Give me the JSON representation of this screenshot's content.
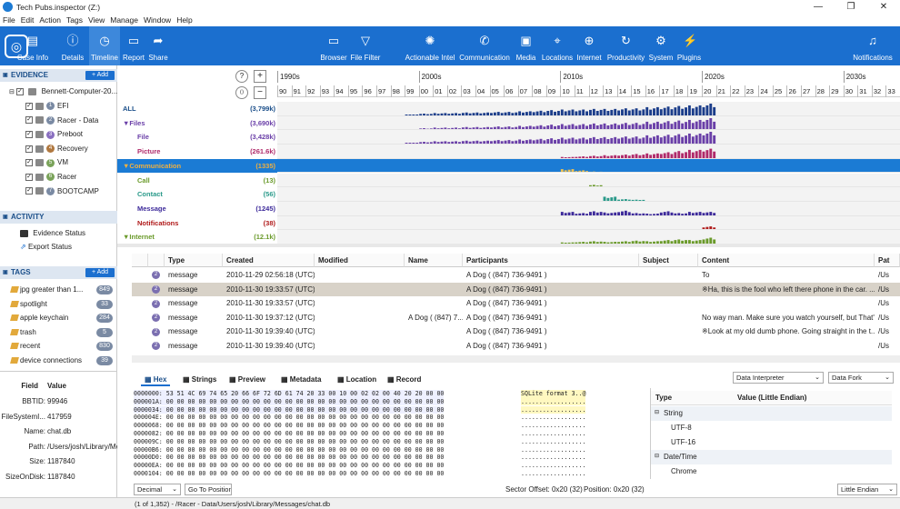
{
  "window": {
    "title": "Tech Pubs.inspector (Z:)",
    "controls": [
      "—",
      "❐",
      "✕"
    ]
  },
  "menu": [
    "File",
    "Edit",
    "Action",
    "Tags",
    "View",
    "Manage",
    "Window",
    "Help"
  ],
  "ribbon": {
    "left": [
      {
        "label": "Case Info",
        "icon": "case-info-icon",
        "glyph": "▤"
      },
      {
        "label": "Details",
        "icon": "details-icon",
        "glyph": "ⓘ"
      },
      {
        "label": "Timeline",
        "icon": "timeline-icon",
        "glyph": "◷",
        "active": true
      },
      {
        "label": "Report",
        "icon": "report-icon",
        "glyph": "▭"
      },
      {
        "label": "Share",
        "icon": "share-icon",
        "glyph": "➦"
      }
    ],
    "center": [
      {
        "label": "Browser",
        "icon": "folder-icon",
        "glyph": "▭"
      },
      {
        "label": "File Filter",
        "icon": "filter-icon",
        "glyph": "▽"
      },
      {
        "label": "Actionable Intel",
        "icon": "intel-icon",
        "glyph": "✺"
      },
      {
        "label": "Communication",
        "icon": "phone-icon",
        "glyph": "✆"
      },
      {
        "label": "Media",
        "icon": "media-icon",
        "glyph": "▣"
      },
      {
        "label": "Locations",
        "icon": "location-pin-icon",
        "glyph": "⌖"
      },
      {
        "label": "Internet",
        "icon": "globe-icon",
        "glyph": "⊕"
      },
      {
        "label": "Productivity",
        "icon": "productivity-icon",
        "glyph": "↻"
      },
      {
        "label": "System",
        "icon": "gear-icon",
        "glyph": "⚙"
      },
      {
        "label": "Plugins",
        "icon": "plugin-icon",
        "glyph": "⚡"
      }
    ],
    "right": {
      "label": "Notifications",
      "icon": "bell-icon",
      "glyph": "♫"
    }
  },
  "evidence": {
    "title": "EVIDENCE",
    "add_label": "+ Add",
    "root": "Bennett-Computer-20...",
    "volumes": [
      {
        "n": "1",
        "name": "EFI",
        "color": "#7a8aa3"
      },
      {
        "n": "2",
        "name": "Racer - Data",
        "color": "#7a8aa3"
      },
      {
        "n": "3",
        "name": "Preboot",
        "color": "#8a6fc0"
      },
      {
        "n": "4",
        "name": "Recovery",
        "color": "#b0783f"
      },
      {
        "n": "5",
        "name": "VM",
        "color": "#7aa35a"
      },
      {
        "n": "6",
        "name": "Racer",
        "color": "#7aa35a"
      },
      {
        "n": "7",
        "name": "BOOTCAMP",
        "color": "#7a8aa3"
      }
    ]
  },
  "activity": {
    "title": "ACTIVITY",
    "items": [
      "Evidence Status",
      "Export Status"
    ]
  },
  "tags": {
    "title": "TAGS",
    "add_label": "+ Add",
    "items": [
      {
        "name": "jpg greater than 1...",
        "count": "849"
      },
      {
        "name": "spotlight",
        "count": "33"
      },
      {
        "name": "apple keychain",
        "count": "284"
      },
      {
        "name": "trash",
        "count": "5"
      },
      {
        "name": "recent",
        "count": "830"
      },
      {
        "name": "device connections",
        "count": "39"
      }
    ]
  },
  "fieldvalue": {
    "headers": [
      "Field",
      "Value"
    ],
    "rows": [
      {
        "field": "BBTID:",
        "value": "99946"
      },
      {
        "field": "FileSystemI...",
        "value": "417959"
      },
      {
        "field": "Name:",
        "value": "chat.db"
      },
      {
        "field": "Path:",
        "value": "/Users/josh/Library/Me"
      },
      {
        "field": "Size:",
        "value": "1187840"
      },
      {
        "field": "SizeOnDisk:",
        "value": "1187840"
      }
    ]
  },
  "timeline": {
    "zoom_buttons": [
      "?",
      "+",
      "⟨⟩",
      "−"
    ],
    "decades": [
      {
        "label": "1990s",
        "start": 0
      },
      {
        "label": "2000s",
        "start": 10
      },
      {
        "label": "2010s",
        "start": 20
      },
      {
        "label": "2020s",
        "start": 30
      },
      {
        "label": "2030s",
        "start": 40
      }
    ],
    "years": [
      "90",
      "91",
      "92",
      "93",
      "94",
      "95",
      "96",
      "97",
      "98",
      "99",
      "00",
      "01",
      "02",
      "03",
      "04",
      "05",
      "06",
      "07",
      "08",
      "09",
      "10",
      "11",
      "12",
      "13",
      "14",
      "15",
      "16",
      "17",
      "18",
      "19",
      "20",
      "21",
      "22",
      "23",
      "24",
      "25",
      "26",
      "27",
      "28",
      "29",
      "30",
      "31",
      "32",
      "33"
    ],
    "rows": [
      {
        "label": "ALL",
        "count": "(3,799k)",
        "color": "#1b4f8a",
        "bar_color": "#1b3d8a",
        "indent": 0,
        "selected": false,
        "levels": [
          0,
          0,
          0,
          0,
          0,
          0,
          0,
          0,
          0,
          0.05,
          0.15,
          0.2,
          0.2,
          0.25,
          0.25,
          0.3,
          0.3,
          0.35,
          0.4,
          0.45,
          0.5,
          0.5,
          0.55,
          0.55,
          0.6,
          0.6,
          0.7,
          0.75,
          0.8,
          0.85,
          1,
          0,
          0,
          0,
          0,
          0,
          0,
          0,
          0,
          0,
          0,
          0,
          0,
          0
        ]
      },
      {
        "label": "▼Files",
        "count": "(3,690k)",
        "color": "#6a3fa8",
        "bar_color": "#6a3fa8",
        "indent": 0,
        "selected": false,
        "levels": [
          0,
          0,
          0,
          0,
          0,
          0,
          0,
          0,
          0,
          0.05,
          0.15,
          0.2,
          0.2,
          0.25,
          0.25,
          0.3,
          0.3,
          0.35,
          0.4,
          0.45,
          0.5,
          0.5,
          0.55,
          0.55,
          0.6,
          0.6,
          0.7,
          0.75,
          0.8,
          0.85,
          1,
          0,
          0,
          0,
          0,
          0,
          0,
          0,
          0,
          0,
          0,
          0,
          0,
          0
        ]
      },
      {
        "label": "File",
        "count": "(3,428k)",
        "color": "#6a3fa8",
        "bar_color": "#6a3fa8",
        "indent": 16,
        "selected": false,
        "levels": [
          0,
          0,
          0,
          0,
          0,
          0,
          0,
          0,
          0,
          0.05,
          0.15,
          0.2,
          0.2,
          0.25,
          0.25,
          0.3,
          0.3,
          0.35,
          0.4,
          0.45,
          0.5,
          0.5,
          0.55,
          0.55,
          0.6,
          0.6,
          0.7,
          0.75,
          0.8,
          0.85,
          1,
          0,
          0,
          0,
          0,
          0,
          0,
          0,
          0,
          0,
          0,
          0,
          0,
          0
        ]
      },
      {
        "label": "Picture",
        "count": "(261.6k)",
        "color": "#b02a6a",
        "bar_color": "#b02a6a",
        "indent": 16,
        "selected": false,
        "levels": [
          0,
          0,
          0,
          0,
          0,
          0,
          0,
          0,
          0,
          0,
          0,
          0,
          0,
          0,
          0,
          0,
          0,
          0,
          0,
          0,
          0.1,
          0.15,
          0.2,
          0.25,
          0.3,
          0.35,
          0.4,
          0.5,
          0.6,
          0.7,
          0.8,
          0,
          0,
          0,
          0,
          0,
          0,
          0,
          0,
          0,
          0,
          0,
          0,
          0
        ]
      },
      {
        "label": "▼Communication",
        "count": "(1335)",
        "color": "#e2a93b",
        "bar_color": "#e2a93b",
        "indent": 0,
        "selected": true,
        "levels": [
          0,
          0,
          0,
          0,
          0,
          0,
          0,
          0,
          0,
          0,
          0,
          0,
          0,
          0,
          0,
          0,
          0,
          0,
          0,
          0,
          0.3,
          0.2,
          0.1,
          0,
          0,
          0,
          0,
          0,
          0,
          0,
          0,
          0,
          0,
          0,
          0,
          0,
          0,
          0,
          0,
          0,
          0,
          0,
          0,
          0
        ]
      },
      {
        "label": "Call",
        "count": "(13)",
        "color": "#6a9a2a",
        "bar_color": "#6a9a2a",
        "indent": 16,
        "selected": false,
        "levels": [
          0,
          0,
          0,
          0,
          0,
          0,
          0,
          0,
          0,
          0,
          0,
          0,
          0,
          0,
          0,
          0,
          0,
          0,
          0,
          0,
          0,
          0,
          0.2,
          0,
          0,
          0,
          0,
          0,
          0,
          0,
          0,
          0,
          0,
          0,
          0,
          0,
          0,
          0,
          0,
          0,
          0,
          0,
          0,
          0
        ]
      },
      {
        "label": "Contact",
        "count": "(56)",
        "color": "#2a9a8a",
        "bar_color": "#2a9a8a",
        "indent": 16,
        "selected": false,
        "levels": [
          0,
          0,
          0,
          0,
          0,
          0,
          0,
          0,
          0,
          0,
          0,
          0,
          0,
          0,
          0,
          0,
          0,
          0,
          0,
          0,
          0,
          0,
          0,
          0.35,
          0.15,
          0.1,
          0,
          0,
          0,
          0,
          0,
          0,
          0,
          0,
          0,
          0,
          0,
          0,
          0,
          0,
          0,
          0,
          0,
          0
        ]
      },
      {
        "label": "Message",
        "count": "(1245)",
        "color": "#3d2a9a",
        "bar_color": "#3d2a9a",
        "indent": 16,
        "selected": false,
        "levels": [
          0,
          0,
          0,
          0,
          0,
          0,
          0,
          0,
          0,
          0,
          0,
          0,
          0,
          0,
          0,
          0,
          0,
          0,
          0,
          0,
          0.3,
          0.2,
          0.35,
          0.25,
          0.4,
          0.2,
          0.15,
          0.35,
          0.2,
          0.3,
          0.3,
          0,
          0,
          0,
          0,
          0,
          0,
          0,
          0,
          0,
          0,
          0,
          0,
          0
        ]
      },
      {
        "label": "Notifications",
        "count": "(38)",
        "color": "#b01a1a",
        "bar_color": "#b01a1a",
        "indent": 16,
        "selected": false,
        "levels": [
          0,
          0,
          0,
          0,
          0,
          0,
          0,
          0,
          0,
          0,
          0,
          0,
          0,
          0,
          0,
          0,
          0,
          0,
          0,
          0,
          0,
          0,
          0,
          0,
          0,
          0,
          0,
          0,
          0,
          0,
          0.3,
          0,
          0,
          0,
          0,
          0,
          0,
          0,
          0,
          0,
          0,
          0,
          0,
          0
        ]
      },
      {
        "label": "▼Internet",
        "count": "(12.1k)",
        "color": "#6a9a2a",
        "bar_color": "#6a9a2a",
        "indent": 0,
        "selected": false,
        "levels": [
          0,
          0,
          0,
          0,
          0,
          0,
          0,
          0,
          0,
          0,
          0,
          0,
          0,
          0,
          0,
          0,
          0,
          0,
          0,
          0,
          0.1,
          0.15,
          0.2,
          0.15,
          0.2,
          0.25,
          0.2,
          0.3,
          0.35,
          0.3,
          0.5,
          0,
          0,
          0,
          0,
          0,
          0,
          0,
          0,
          0,
          0,
          0,
          0,
          0
        ]
      }
    ]
  },
  "grid": {
    "columns": [
      {
        "label": "",
        "w": 18
      },
      {
        "label": "",
        "w": 18
      },
      {
        "label": "Type",
        "w": 64
      },
      {
        "label": "Created",
        "w": 101
      },
      {
        "label": "Modified",
        "w": 99
      },
      {
        "label": "Name",
        "w": 64
      },
      {
        "label": "Participants",
        "w": 194
      },
      {
        "label": "Subject",
        "w": 65
      },
      {
        "label": "Content",
        "w": 194
      },
      {
        "label": "Pat",
        "w": 28
      }
    ],
    "rows": [
      {
        "type": "message",
        "created": "2010-11-29 02:56:18 (UTC)",
        "modified": "",
        "name": "",
        "participants": "A Dog ( (847) 736-9491 )",
        "subject": "",
        "content": "To",
        "path": "/Us",
        "selected": false
      },
      {
        "type": "message",
        "created": "2010-11-30 19:33:57 (UTC)",
        "modified": "",
        "name": "",
        "participants": "A Dog ( (847) 736-9491 )",
        "subject": "",
        "content": "※Ha, this is the fool who left there phone in the car. ...",
        "path": "/Us",
        "selected": true
      },
      {
        "type": "message",
        "created": "2010-11-30 19:33:57 (UTC)",
        "modified": "",
        "name": "",
        "participants": "A Dog ( (847) 736-9491 )",
        "subject": "",
        "content": "",
        "path": "/Us",
        "selected": false
      },
      {
        "type": "message",
        "created": "2010-11-30 19:37:12 (UTC)",
        "modified": "",
        "name": "A Dog ( (847) 7...",
        "participants": "A Dog ( (847) 736-9491 )",
        "subject": "",
        "content": "No way man. Make sure you watch yourself, but That''...",
        "path": "/Us",
        "selected": false
      },
      {
        "type": "message",
        "created": "2010-11-30 19:39:40 (UTC)",
        "modified": "",
        "name": "",
        "participants": "A Dog ( (847) 736-9491 )",
        "subject": "",
        "content": "※Look at my old dumb phone. Going straight in the t...",
        "path": "/Us",
        "selected": false
      },
      {
        "type": "message",
        "created": "2010-11-30 19:39:40 (UTC)",
        "modified": "",
        "name": "",
        "participants": "A Dog ( (847) 736-9491 )",
        "subject": "",
        "content": "",
        "path": "/Us",
        "selected": false
      }
    ]
  },
  "hextabs": [
    {
      "label": "Hex",
      "icon": "hex-icon",
      "active": true
    },
    {
      "label": "Strings",
      "icon": "strings-icon",
      "active": false
    },
    {
      "label": "Preview",
      "icon": "preview-icon",
      "active": false
    },
    {
      "label": "Metadata",
      "icon": "metadata-icon",
      "active": false
    },
    {
      "label": "Location",
      "icon": "location-pin-icon",
      "active": false
    },
    {
      "label": "Record",
      "icon": "record-icon",
      "active": false
    }
  ],
  "hex": {
    "lines": [
      "0000000: 53 51 4C 69 74 65 20 66 6F 72 6D 61 74 20 33 00 10 00 02 02 00 40 20 20 00 00",
      "000001A: 00 00 00 00 00 00 00 00 00 00 00 00 00 00 00 00 00 00 00 00 00 00 00 00 00 00",
      "0000034: 00 00 00 00 00 00 00 00 00 00 00 00 00 00 00 00 00 00 00 00 00 00 00 00 00 00",
      "000004E: 00 00 00 00 00 00 00 00 00 00 00 00 00 00 00 00 00 00 00 00 00 00 00 00 00 00",
      "0000068: 00 00 00 00 00 00 00 00 00 00 00 00 00 00 00 00 00 00 00 00 00 00 00 00 00 00",
      "0000082: 00 00 00 00 00 00 00 00 00 00 00 00 00 00 00 00 00 00 00 00 00 00 00 00 00 00",
      "000009C: 00 00 00 00 00 00 00 00 00 00 00 00 00 00 00 00 00 00 00 00 00 00 00 00 00 00",
      "00000B6: 00 00 00 00 00 00 00 00 00 00 00 00 00 00 00 00 00 00 00 00 00 00 00 00 00 00",
      "00000D0: 00 00 00 00 00 00 00 00 00 00 00 00 00 00 00 00 00 00 00 00 00 00 00 00 00 00",
      "00000EA: 00 00 00 00 00 00 00 00 00 00 00 00 00 00 00 00 00 00 00 00 00 00 00 00 00 00",
      "0000104: 00 00 00 00 00 00 00 00 00 00 00 00 00 00 00 00 00 00 00 00 00 00 00 00 00 00"
    ],
    "ascii": [
      "SQLite format 3..@",
      "..................",
      "..................",
      "..................",
      "..................",
      "..................",
      "..................",
      "..................",
      "..................",
      "..................",
      ".................."
    ]
  },
  "interpreter": {
    "dropdown": "Data Interpreter",
    "fork": "Data Fork",
    "headers": [
      "Type",
      "Value (Little Endian)"
    ],
    "groups": [
      {
        "label": "String",
        "items": [
          "UTF-8",
          "UTF-16"
        ]
      },
      {
        "label": "Date/Time",
        "items": [
          "Chrome"
        ]
      }
    ]
  },
  "bottombar": {
    "format": "Decimal",
    "goto": "Go To Position",
    "sector": "Sector Offset: 0x20 (32)",
    "position": "Position: 0x20 (32)",
    "endian": "Little Endian"
  },
  "status": "(1 of 1,352)  -  /Racer - Data/Users/josh/Library/Messages/chat.db"
}
